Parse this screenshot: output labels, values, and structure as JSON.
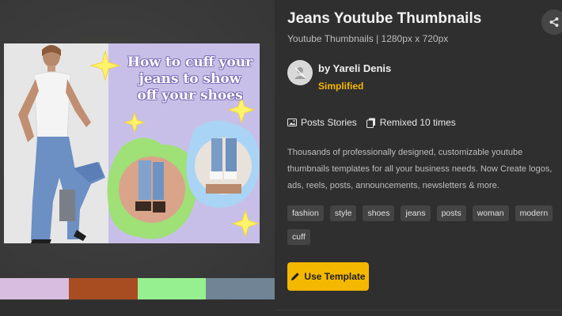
{
  "preview": {
    "headline": [
      "How to cuff your",
      "jeans to show",
      "off your shoes"
    ],
    "swatches": [
      "#d8bde0",
      "#a84c22",
      "#96f08f",
      "#708496"
    ]
  },
  "details": {
    "title": "Jeans Youtube Thumbnails",
    "subtitle": "Youtube Thumbnails | 1280px x 720px",
    "author": "by Yareli Denis",
    "brand": "Simplified",
    "category": "Posts Stories",
    "remixed": "Remixed 10 times",
    "description": "Thousands of professionally designed, customizable youtube thumbnails templates for all your business needs. Now Create logos, ads, reels, posts, announcements, newsletters & more.",
    "tags": [
      "fashion",
      "style",
      "shoes",
      "jeans",
      "posts",
      "woman",
      "modern",
      "cuff"
    ],
    "use_button": "Use Template"
  },
  "icons": {
    "share": "share-icon",
    "avatar": "user-placeholder-icon",
    "category": "image-icon",
    "remix": "copy-icon",
    "edit": "pencil-icon"
  },
  "colors": {
    "accent": "#f5b800",
    "background": "#2f2f2f",
    "tag_bg": "#444444"
  }
}
